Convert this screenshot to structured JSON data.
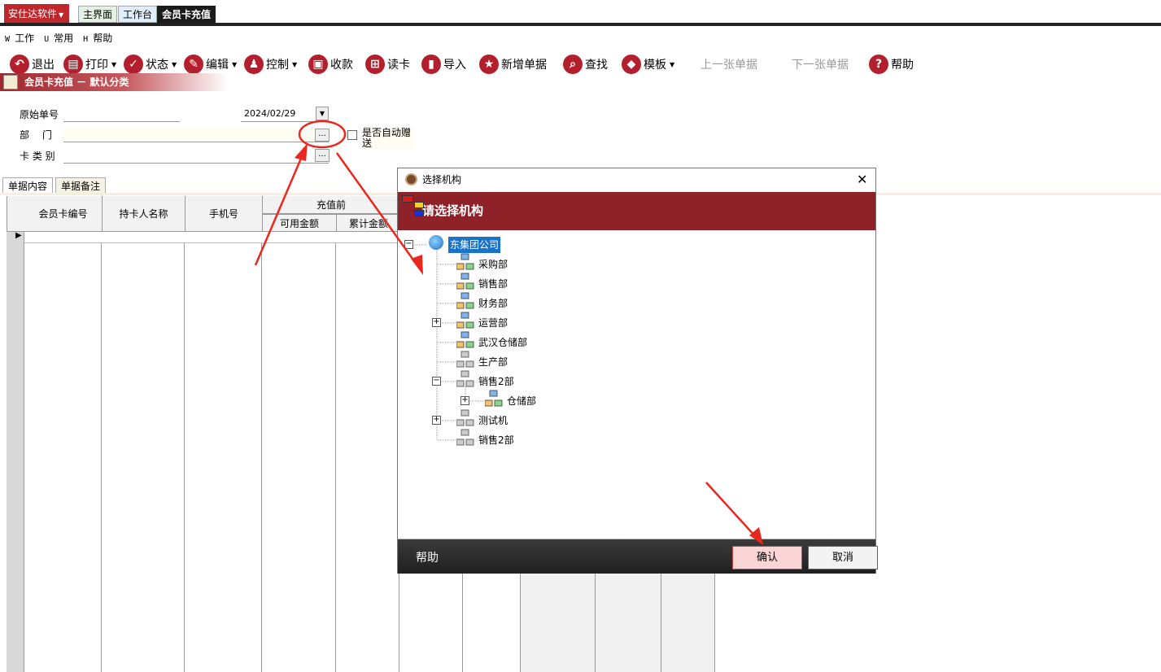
{
  "app": {
    "brand": "安仕达软件",
    "tabs": [
      "主界面",
      "工作台",
      "会员卡充值"
    ]
  },
  "menu": [
    {
      "key": "W",
      "label": "工作"
    },
    {
      "key": "U",
      "label": "常用"
    },
    {
      "key": "H",
      "label": "帮助"
    }
  ],
  "toolbar": {
    "exit": "退出",
    "print": "打印",
    "status": "状态",
    "edit": "编辑",
    "control": "控制",
    "collect": "收款",
    "readcard": "读卡",
    "import": "导入",
    "newdoc": "新增单据",
    "find": "查找",
    "template": "模板",
    "prev": "上一张单据",
    "next": "下一张单据",
    "help": "帮助"
  },
  "page_title": "会员卡充值 － 默认分类",
  "form": {
    "orig_no_label": "原始单号",
    "dept_label": "部　 门",
    "cardtype_label": "卡 类 别",
    "date": "2024/02/29",
    "auto_gift_label": "是否自动赠送",
    "dots": "..."
  },
  "detail_tabs": [
    "单据内容",
    "单据备注"
  ],
  "grid": {
    "headers": [
      "会员卡编号",
      "持卡人名称",
      "手机号"
    ],
    "group_header": "充值前",
    "sub_headers": [
      "可用金额",
      "累计金额"
    ]
  },
  "dialog": {
    "title": "选择机构",
    "banner": "请选择机构",
    "help": "帮助",
    "confirm": "确认",
    "cancel": "取消",
    "tree": [
      {
        "label": "东集团公司"
      },
      {
        "label": "采购部"
      },
      {
        "label": "销售部"
      },
      {
        "label": "财务部"
      },
      {
        "label": "运营部"
      },
      {
        "label": "武汉仓储部"
      },
      {
        "label": "生产部"
      },
      {
        "label": "销售2部"
      },
      {
        "label": "仓储部"
      },
      {
        "label": "测试机"
      },
      {
        "label": "销售2部"
      }
    ]
  },
  "colors": {
    "brand_red": "#c0272d",
    "banner_red": "#8e2228",
    "annotation_red": "#e8281f"
  }
}
